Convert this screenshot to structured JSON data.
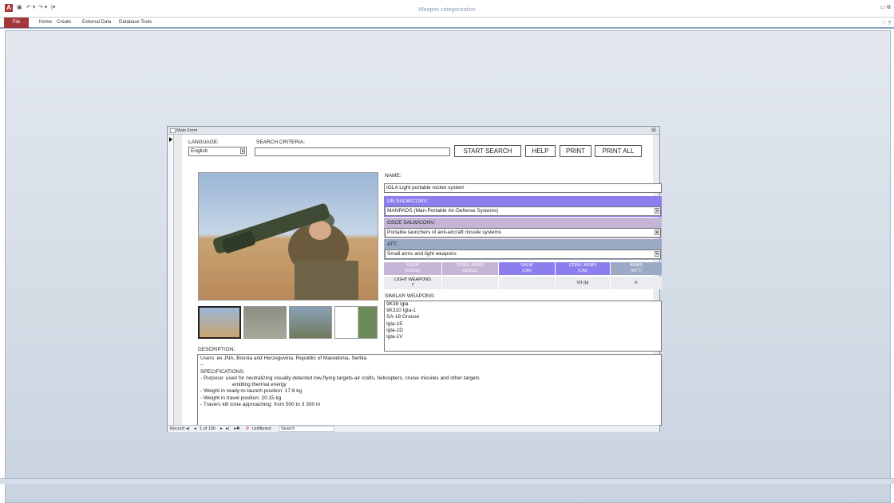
{
  "window": {
    "title": "Weapon categorization"
  },
  "ribbon": {
    "file": "File",
    "tabs": [
      "Home",
      "Create",
      "External Data",
      "Database Tools"
    ]
  },
  "form": {
    "title": "Main Form",
    "language_label": "LANGUAGE:",
    "language_value": "English",
    "search_label": "SEARCH CRITERIA:",
    "search_value": "",
    "buttons": {
      "start_search": "START SEARCH",
      "help": "HELP",
      "print": "PRINT",
      "print_all": "PRINT ALL"
    },
    "name_label": "NAME:",
    "name_value": "IGLA Light portable rocket system",
    "un_label": "UN SALW/CONV:",
    "un_value": "MANPADS (Man-Portable Air-Defense Systems)",
    "osce_label": "OSCE SALW/CONV:",
    "osce_value": "Portable launchers of anti-aircraft missile systems",
    "att_label": "ATT:",
    "att_value": "Small arms and light weapons",
    "grid_headers": [
      "SALW\n(OSCE)",
      "CONV. ARMS\n(OSCE)",
      "SALW\n(UN)",
      "CONV. ARMS\n(UN)",
      "ARMS\n(ATT)"
    ],
    "grid_values": [
      "LIGHT WEAPONS\n7",
      "",
      "",
      "VII (b)",
      "h"
    ],
    "similar_label": "SIMILAR WEAPONS:",
    "similar": [
      "9K38 Igla",
      "9K310 Igla-1",
      "SA-18 Grouse",
      "Igla-1E",
      "Igla-1D",
      "Igla-1V"
    ],
    "description_label": "DESCRIPTION:",
    "description_lines": [
      "Users: ex JNA, Bosnia and Herzegovina, Republic of Macedonia, Serbia",
      "--",
      "SPECIFICATIONS:",
      "- Purpose: used for neutralizing visually detected low-flying targets-air crafts, helicopters, cruise missiles and other targets",
      "emitting thermal energy",
      "- Weight in ready-to-launch position: 17.9 kg",
      "- Weight in travel position: 20.15 kg",
      "- Travers kill zone approaching: from 500 to 3 300 m"
    ],
    "nav": {
      "record_label": "Record:",
      "position": "1 of 106",
      "filter": "Unfiltered",
      "search": "Search"
    }
  },
  "colors": {
    "un_header": "#8d7ef0",
    "osce_header": "#c4b5d6",
    "att_header": "#9aa9c4",
    "file_tab": "#a4373a"
  }
}
